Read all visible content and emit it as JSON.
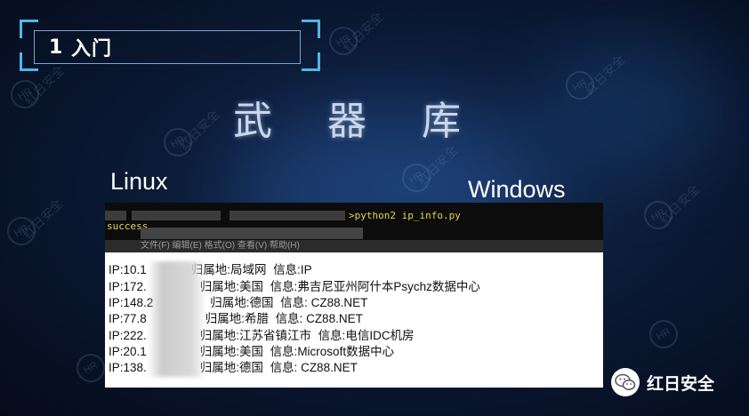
{
  "section": {
    "number": "1",
    "title": "入门"
  },
  "main_title": "武器库",
  "labels": {
    "linux": "Linux",
    "windows": "Windows"
  },
  "terminal": {
    "command": "python2 ip_info.py",
    "output": "success",
    "menu": "文件(F)  编辑(E)  格式(O)  查看(V)  帮助(H)"
  },
  "results": [
    {
      "ip": "IP:10.1",
      "location": "归属地:局域网",
      "info": "信息:IP"
    },
    {
      "ip": "IP:172.",
      "location": "归属地:美国",
      "info": "信息:弗吉尼亚州阿什本Psychz数据中心"
    },
    {
      "ip": "IP:148.2",
      "location": "归属地:德国",
      "info": "信息: CZ88.NET"
    },
    {
      "ip": "IP:77.8",
      "location": "归属地:希腊",
      "info": "信息: CZ88.NET"
    },
    {
      "ip": "IP:222.",
      "location": "归属地:江苏省镇江市",
      "info": "信息:电信IDC机房"
    },
    {
      "ip": "IP:20.1",
      "location": "归属地:美国",
      "info": "信息:Microsoft数据中心"
    },
    {
      "ip": "IP:138.",
      "location": "归属地:德国",
      "info": "信息: CZ88.NET"
    }
  ],
  "brand": {
    "name": "红日安全",
    "icon": "wechat-icon"
  },
  "watermark_text": "红日安全",
  "colors": {
    "accent": "#4fb7e6",
    "terminal_text": "#e8d44d",
    "background": "#0b1a36"
  }
}
